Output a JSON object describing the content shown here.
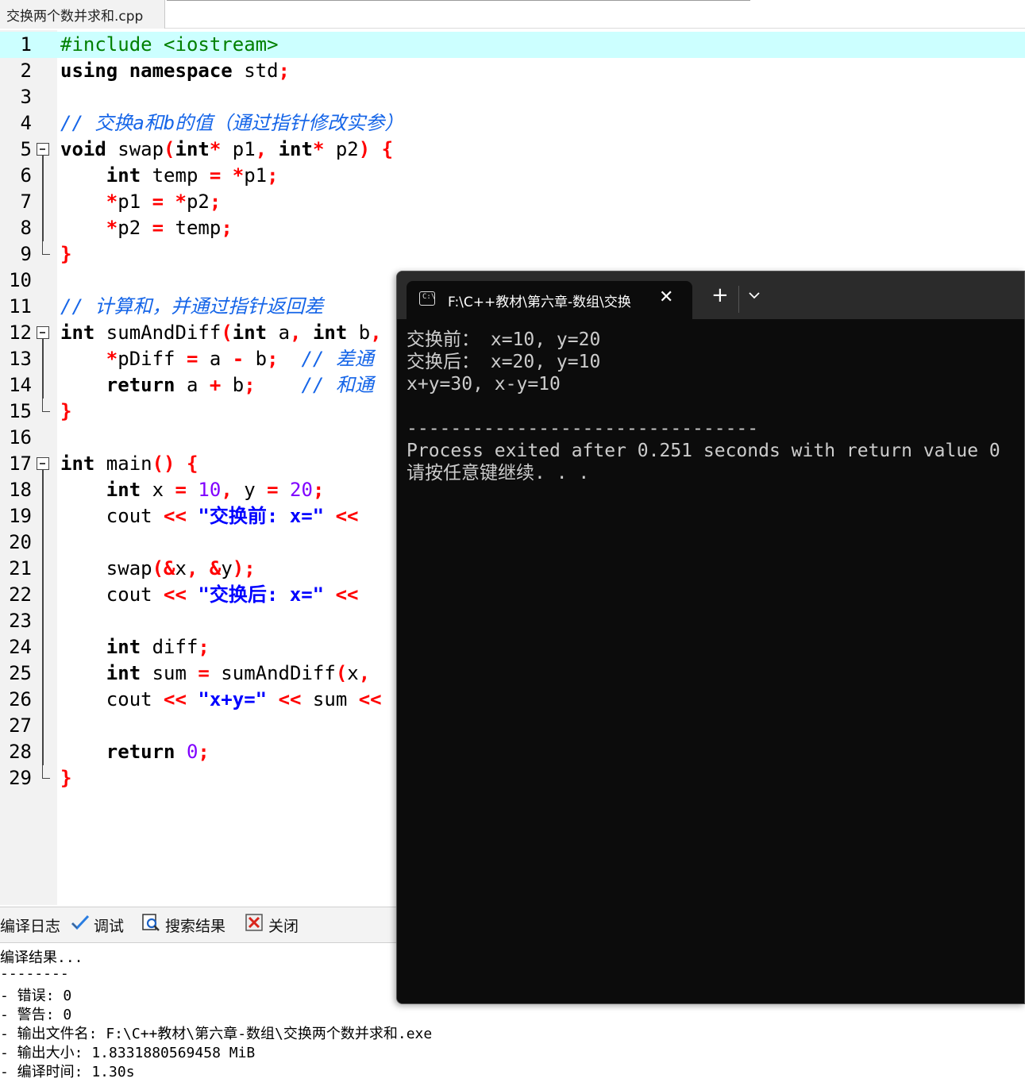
{
  "file_tab": {
    "label": "交换两个数并求和.cpp"
  },
  "editor": {
    "line_numbers": [
      "1",
      "2",
      "3",
      "4",
      "5",
      "6",
      "7",
      "8",
      "9",
      "10",
      "11",
      "12",
      "13",
      "14",
      "15",
      "16",
      "17",
      "18",
      "19",
      "20",
      "21",
      "22",
      "23",
      "24",
      "25",
      "26",
      "27",
      "28",
      "29"
    ],
    "current_line": 1
  },
  "console": {
    "tab_title": "F:\\C++教材\\第六章-数组\\交换",
    "tab_icon": "terminal-icon",
    "output": [
      "交换前： x=10, y=20",
      "交换后： x=20, y=10",
      "x+y=30, x-y=10",
      "",
      "--------------------------------",
      "Process exited after 0.251 seconds with return value 0",
      "请按任意键继续. . ."
    ]
  },
  "bottom_tabs": [
    {
      "label": "编译日志",
      "icon": "compile-log-icon"
    },
    {
      "label": "调试",
      "icon": "check-icon"
    },
    {
      "label": "搜索结果",
      "icon": "search-icon"
    },
    {
      "label": "关闭",
      "icon": "close-icon"
    }
  ],
  "compile_log": [
    "编译结果...",
    "--------",
    "- 错误: 0",
    "- 警告: 0",
    "- 输出文件名: F:\\C++教材\\第六章-数组\\交换两个数并求和.exe",
    "- 输出大小: 1.8331880569458 MiB",
    "- 编译时间: 1.30s"
  ],
  "colors": {
    "current_line": "#ccffff",
    "comment": "#1565e8",
    "operator": "#ff0000",
    "number": "#8000ff",
    "string": "#0000ff",
    "preprocessor": "#008000",
    "console_bg": "#0c0c0c",
    "console_text": "#cccccc"
  }
}
